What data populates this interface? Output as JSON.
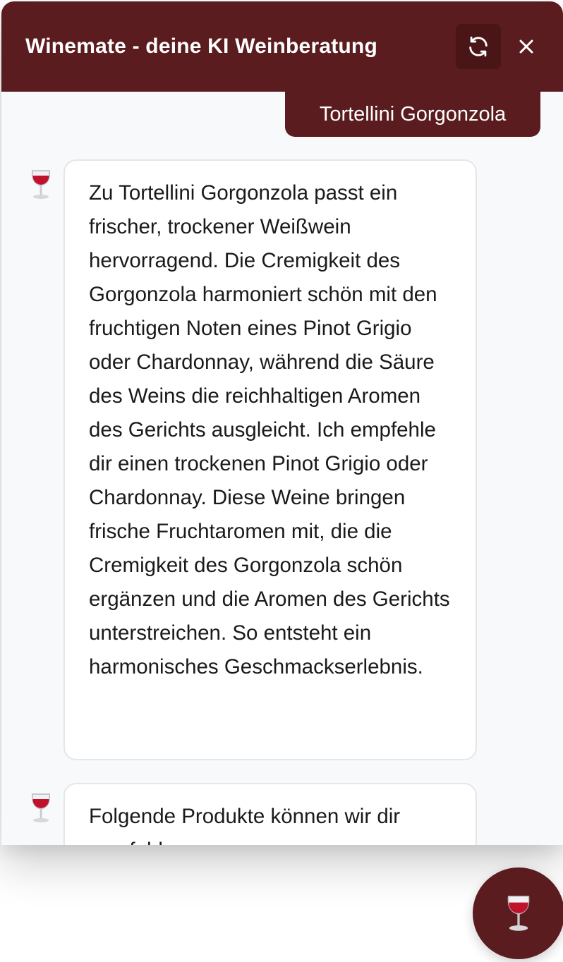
{
  "header": {
    "title": "Winemate - deine KI Weinberatung",
    "refresh_icon": "refresh-icon",
    "close_icon": "close-icon"
  },
  "messages": [
    {
      "role": "user",
      "text": "Tortellini Gorgonzola"
    },
    {
      "role": "bot",
      "icon": "wine-glass-icon",
      "text": "Zu Tortellini Gorgonzola passt ein frischer, trockener Weißwein hervorragend. Die Cremigkeit des Gorgonzola harmoniert schön mit den fruchtigen Noten eines Pinot Grigio oder Chardonnay, während die Säure des Weins die reichhaltigen Aromen des Gerichts ausgleicht. Ich empfehle dir einen trockenen Pinot Grigio oder Chardonnay. Diese Weine bringen frische Fruchtaromen mit, die die Cremigkeit des Gorgonzola schön ergänzen und die Aromen des Gerichts unterstreichen. So entsteht ein harmonisches Geschmackserlebnis."
    },
    {
      "role": "bot",
      "icon": "wine-glass-icon",
      "text": "Folgende Produkte können wir dir empfehlen:"
    }
  ],
  "fab": {
    "icon": "wine-glass-icon"
  },
  "colors": {
    "brand": "#5a1c1e",
    "brand_dark": "#4a1517",
    "chat_background": "#f8f9fb",
    "bubble_border": "#e4e6ea"
  }
}
